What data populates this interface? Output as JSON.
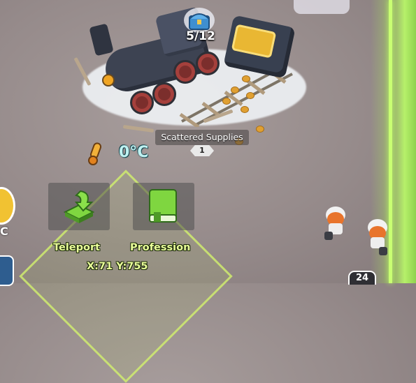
{
  "resource": {
    "chest_count": "5/12",
    "name": "Scattered Supplies",
    "level": "1"
  },
  "weather": {
    "temperature": "0°C"
  },
  "actions": {
    "teleport_label": "Teleport",
    "profession_label": "Profession"
  },
  "position": {
    "coords": "X:71 Y:755"
  },
  "left_panel": {
    "letter": "C"
  },
  "squad": {
    "count": "24"
  },
  "colors": {
    "accent_green": "#eaff9a",
    "temperature_text": "#bff2f2",
    "edge_glow": "#c9ff73"
  },
  "icons": {
    "chest": "treasure-chest-icon",
    "thermometer": "thermometer-icon",
    "teleport": "teleport-arrow-icon",
    "profession": "book-icon"
  }
}
